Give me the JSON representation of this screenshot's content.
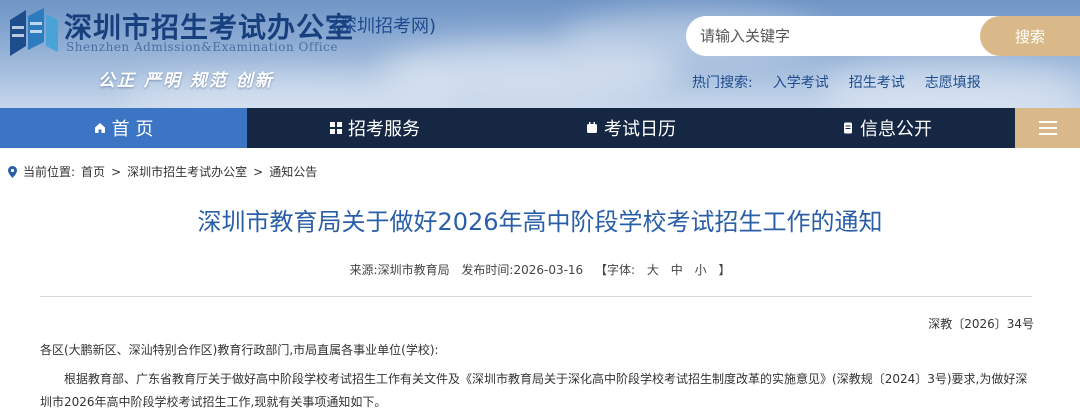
{
  "header": {
    "title": "深圳市招生考试办公室",
    "subtitle": "(深圳招考网)",
    "english": "Shenzhen Admission&Examination Office",
    "slogan": "公正 严明 规范 创新"
  },
  "search": {
    "placeholder": "请输入关键字",
    "button_label": "搜索",
    "hot_label": "热门搜索:",
    "hot_links": [
      "入学考试",
      "招生考试",
      "志愿填报"
    ]
  },
  "nav": {
    "items": [
      "首 页",
      "招考服务",
      "考试日历",
      "信息公开"
    ],
    "active_color": "#3b75c4",
    "bg_color": "#162743",
    "accent_color": "#d9b98a"
  },
  "breadcrumb": {
    "label": "当前位置:",
    "items": [
      "首页",
      "深圳市招生考试办公室",
      "通知公告"
    ],
    "separator": ">"
  },
  "article": {
    "title": "深圳市教育局关于做好2026年高中阶段学校考试招生工作的通知",
    "source": "来源:深圳市教育局",
    "date": "发布时间:2026-03-16",
    "font_size_label": "【字体:",
    "font_sizes": [
      "大",
      "中",
      "小"
    ],
    "font_size_end": "】",
    "doc_number": "深教〔2026〕34号",
    "salutation": "各区(大鹏新区、深汕特别合作区)教育行政部门,市局直属各事业单位(学校):",
    "body": "根据教育部、广东省教育厅关于做好高中阶段学校考试招生工作有关文件及《深圳市教育局关于深化高中阶段学校考试招生制度改革的实施意见》(深教规〔2024〕3号)要求,为做好深圳市2026年高中阶段学校考试招生工作,现就有关事项通知如下。"
  }
}
